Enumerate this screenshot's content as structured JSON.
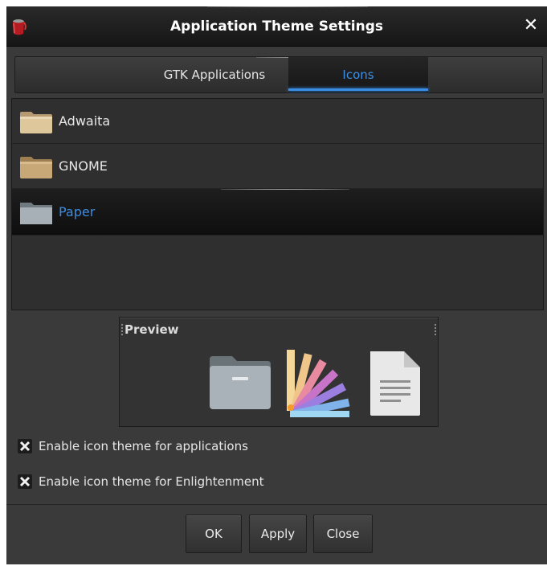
{
  "window": {
    "title": "Application Theme Settings",
    "close_symbol": "✕",
    "app_icon": "paint-bucket-icon"
  },
  "tabs": [
    {
      "label": "GTK Applications",
      "selected": false
    },
    {
      "label": "Icons",
      "selected": true
    }
  ],
  "themes": {
    "items": [
      {
        "label": "Adwaita",
        "icon": "folder-icon",
        "selected": false
      },
      {
        "label": "GNOME",
        "icon": "folder-icon",
        "selected": false
      },
      {
        "label": "Paper",
        "icon": "folder-icon",
        "selected": true
      }
    ]
  },
  "preview": {
    "title": "Preview",
    "icons": [
      "folder-icon",
      "color-swatch-icon",
      "document-icon"
    ]
  },
  "options": [
    {
      "label": "Enable icon theme for applications",
      "checked": true
    },
    {
      "label": "Enable icon theme for Enlightenment",
      "checked": true
    }
  ],
  "buttons": {
    "ok": "OK",
    "apply": "Apply",
    "close": "Close"
  },
  "colors": {
    "accent": "#3a8de5",
    "window_bg": "#3a3a3a",
    "titlebar_bg": "#151515"
  }
}
